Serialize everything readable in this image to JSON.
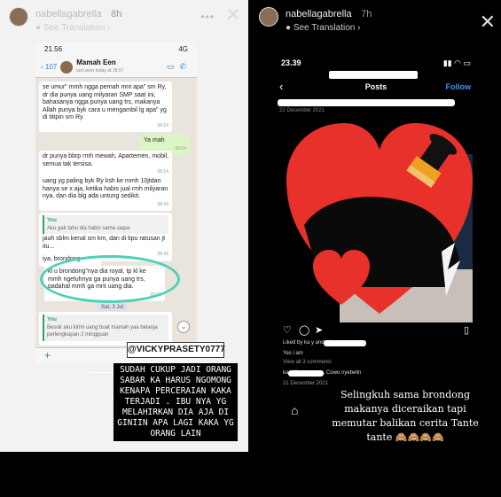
{
  "left_story": {
    "username": "nabellagabrella",
    "time": "8h",
    "translation": "See Translation",
    "chat": {
      "status_time": "21.56",
      "status_signal": "4G",
      "back_count": "107",
      "contact_name": "Mamah Een",
      "contact_sub": "last seen today at 18.07",
      "messages": [
        {
          "text": "se umur\" mmh ngga pernah mnt apa\" sm Ry, dr dia punya uang milyaran SMP saat ini, bahasanya ngga punya uang trs, makanya Allah punya byk cara u mengambil lg apa\" yg di titipin sm Ry.",
          "time": "08.54"
        },
        {
          "text": "Ya mah",
          "time": "08.54"
        },
        {
          "text": "dr punya bbrp rmh mewah, Apartemen, mobil, semua tak tersisa.",
          "time": "08.54"
        },
        {
          "text": "uang yg paling byk Ry ksh ke mmh 10jtdan hanya se x aja, ketika habis jual rmh milyaran nya, dan dia blg ada untung sedikit.",
          "time": "08.49"
        },
        {
          "quote_name": "You",
          "quote_text": "Aku gak tahu dia habis sama siapa",
          "text": "jauh sblm kenal sm km, dan di tipu ratusan jt itu...",
          "time": "08.49"
        },
        {
          "text": "iya, brondong",
          "time": ""
        },
        {
          "text": "kl u brondong\"nya dia royal, tp kl ke mmh ngeluhnya ga punya uang trs, padahal mmh ga mnt uang dia.",
          "time": "09.05"
        },
        {
          "quote_name": "You",
          "quote_text": "Besok aku kirim uang buat mamah yaa belanja perlengkapan 2 mingguan",
          "text": "",
          "time": ""
        }
      ],
      "date_chip": "Sat, 3 Jul"
    },
    "mention": "@VICKYPRASETY0777",
    "caption": "SUDAH CUKUP JADI ORANG SABAR KA HARUS NGOMONG KENAPA PERCERAIAN KAKA TERJADI . IBU NYA YG MELAHIRKAN DIA AJA DI GINIIN APA LAGI KAKA YG ORANG LAIN"
  },
  "right_story": {
    "username": "nabellagabrella",
    "time": "7h",
    "translation": "See Translation",
    "ig": {
      "status_time": "23.39",
      "nav_title": "Posts",
      "follow": "Follow",
      "post_date": "22 December 2021",
      "liked_by": "Liked by ka           y and others",
      "caption": "Yes i am",
      "view_all": "View all 3 comments",
      "comment": "ka            y Yes you are.. Cowo nyebelin",
      "comment_date": "21 December 2021"
    },
    "caption": "Selingkuh sama brondong makanya diceraikan tapi memutar balikan cerita Tante tante 🙈🙈🙈🙈"
  },
  "colors": {
    "heart_red": "#e8312b",
    "whatsapp_green": "#dcf5c5",
    "highlight_teal": "#4fd1b5",
    "ig_follow_blue": "#3797f0"
  }
}
